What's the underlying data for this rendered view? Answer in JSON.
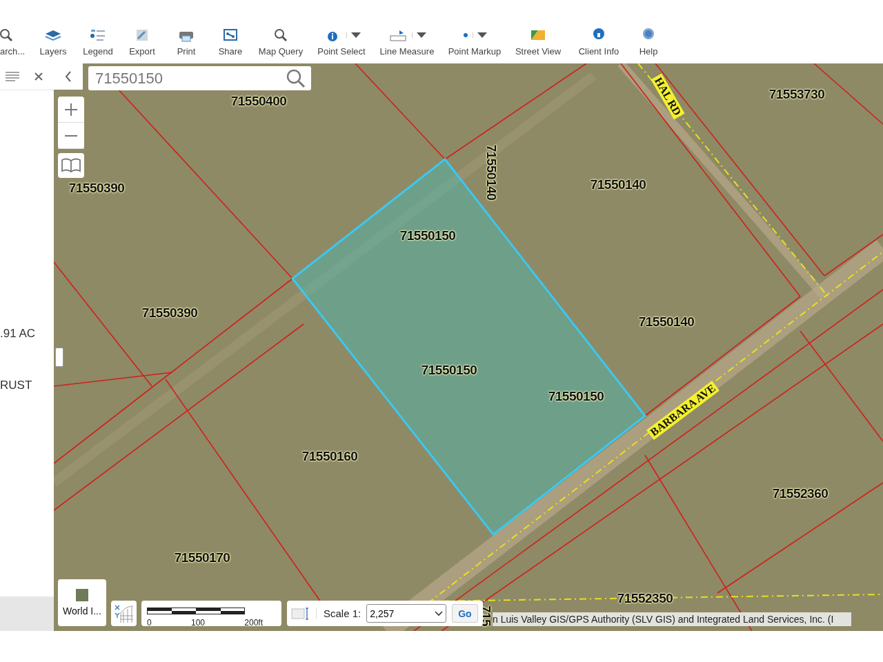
{
  "toolbar": [
    {
      "label": "arch...",
      "has_menu": false
    },
    {
      "label": "Layers",
      "has_menu": false
    },
    {
      "label": "Legend",
      "has_menu": false
    },
    {
      "label": "Export",
      "has_menu": false
    },
    {
      "label": "Print",
      "has_menu": false
    },
    {
      "label": "Share",
      "has_menu": false
    },
    {
      "label": "Map Query",
      "has_menu": false
    },
    {
      "label": "Point Select",
      "has_menu": true
    },
    {
      "label": "Line Measure",
      "has_menu": true
    },
    {
      "label": "Point Markup",
      "has_menu": true
    },
    {
      "label": "Street View",
      "has_menu": false
    },
    {
      "label": "Client Info",
      "has_menu": false
    },
    {
      "label": "Help",
      "has_menu": false
    }
  ],
  "panel": {
    "texts": [
      ".91 AC",
      "RUST"
    ]
  },
  "search": {
    "value": "71550150"
  },
  "map": {
    "parcel_labels": [
      "71550400",
      "71553730",
      "71550390",
      "71550140",
      "71550140",
      "71550150",
      "71550390",
      "71550140",
      "71550150",
      "71550150",
      "71550160",
      "71552360",
      "71550170",
      "71552350",
      "715"
    ],
    "road_labels": [
      "HAL RD",
      "BARBARA AVE"
    ]
  },
  "basemap": {
    "label": "World I..."
  },
  "scale_bar": {
    "ticks": [
      "0",
      "100",
      "200ft"
    ]
  },
  "scale": {
    "label": "Scale 1:",
    "value": "2,257",
    "button": "Go"
  },
  "attribution": "n Luis Valley GIS/GPS Authority (SLV GIS) and Integrated Land Services, Inc. (I"
}
